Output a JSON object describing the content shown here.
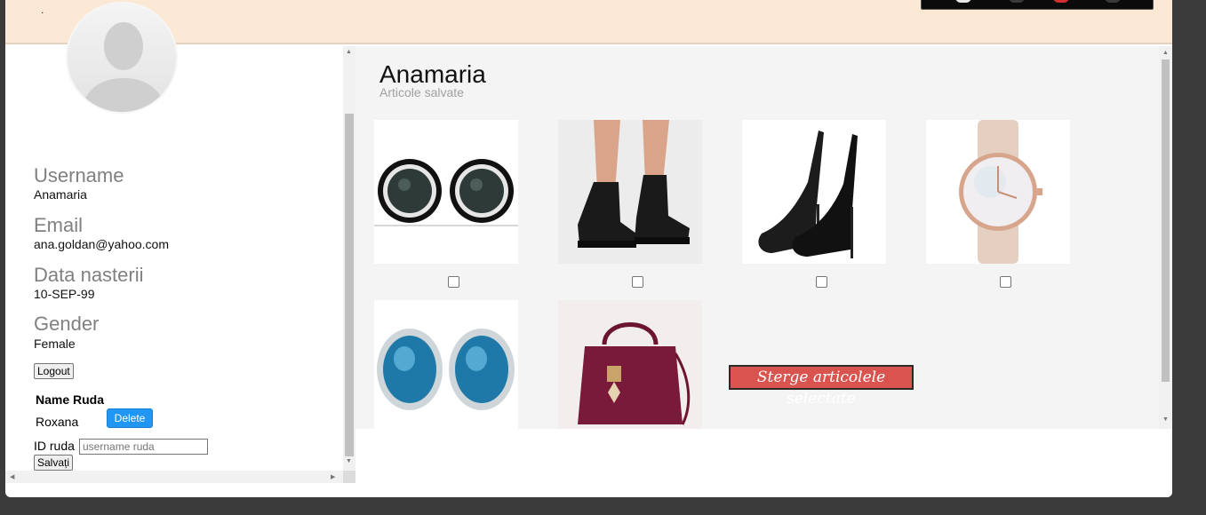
{
  "header": {
    "dot": "."
  },
  "profile": {
    "username_label": "Username",
    "username_value": "Anamaria",
    "email_label": "Email",
    "email_value": "ana.goldan@yahoo.com",
    "birth_label": "Data nasterii",
    "birth_value": "10-SEP-99",
    "gender_label": "Gender",
    "gender_value": "Female",
    "logout_label": "Logout"
  },
  "ruda": {
    "title": "Name Ruda",
    "name": "Roxana",
    "delete_label": "Delete",
    "id_label": "ID ruda",
    "id_placeholder": "username ruda",
    "save_label": "Salvați"
  },
  "main": {
    "title": "Anamaria",
    "subtitle": "Articole salvate",
    "delete_selected_label": "Sterge articolele selectate",
    "products": [
      {
        "name": "pearl-earrings"
      },
      {
        "name": "lace-ankle-boots"
      },
      {
        "name": "black-stiletto-pumps"
      },
      {
        "name": "rose-gold-watch"
      },
      {
        "name": "blue-topaz-earrings"
      },
      {
        "name": "burgundy-handbag"
      }
    ]
  },
  "colors": {
    "header_bg": "#fbe9d6",
    "delete_blue": "#2196f3",
    "delete_selected_red": "#d9534f",
    "label_gray": "#808080"
  }
}
